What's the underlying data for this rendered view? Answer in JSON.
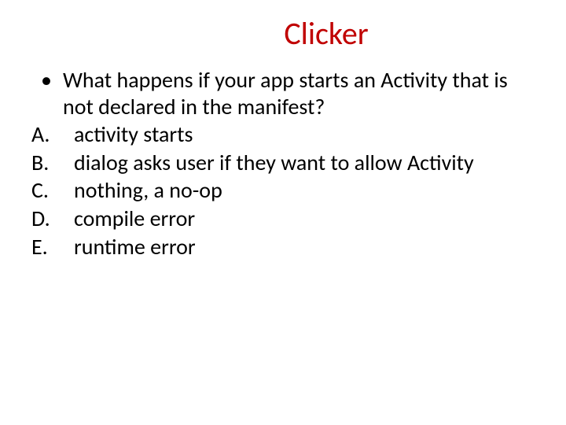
{
  "title": "Clicker",
  "question": "What happens if your app starts an Activity that is not declared in the manifest?",
  "options": [
    {
      "letter": "A.",
      "text": "activity starts"
    },
    {
      "letter": "B.",
      "text": "dialog asks user if they want to allow Activity"
    },
    {
      "letter": "C.",
      "text": "nothing, a no-op"
    },
    {
      "letter": "D.",
      "text": "compile error"
    },
    {
      "letter": "E.",
      "text": "runtime error"
    }
  ]
}
